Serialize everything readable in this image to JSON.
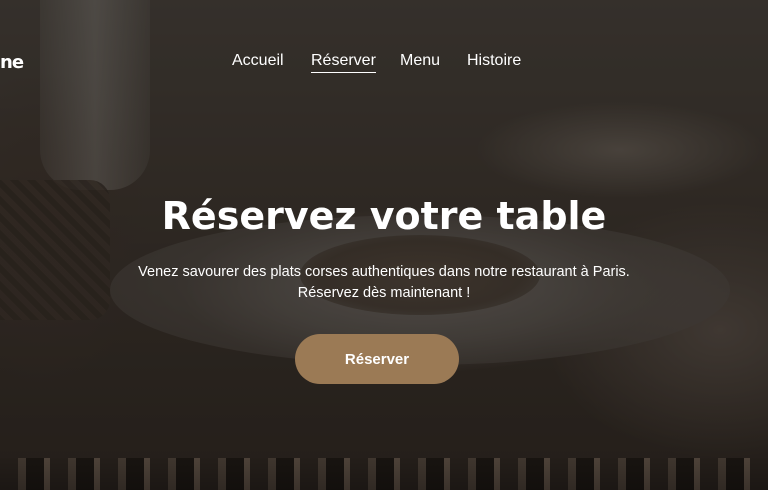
{
  "brand": {
    "logo_fragment": "ne"
  },
  "nav": {
    "items": [
      {
        "label": "Accueil",
        "active": false
      },
      {
        "label": "Réserver",
        "active": true
      },
      {
        "label": "Menu",
        "active": false
      },
      {
        "label": "Histoire",
        "active": false
      }
    ]
  },
  "hero": {
    "title": "Réservez votre table",
    "subtitle_line1": "Venez savourer des plats corses authentiques dans notre restaurant à Paris.",
    "subtitle_line2": "Réservez dès maintenant !",
    "cta_label": "Réserver"
  },
  "colors": {
    "cta_background": "#9b7a55",
    "text": "#ffffff",
    "overlay": "#1e1a16"
  },
  "images": {
    "hero_background": "restaurant-table-plate-photo",
    "bottom_strip": "street-scene-photo"
  }
}
